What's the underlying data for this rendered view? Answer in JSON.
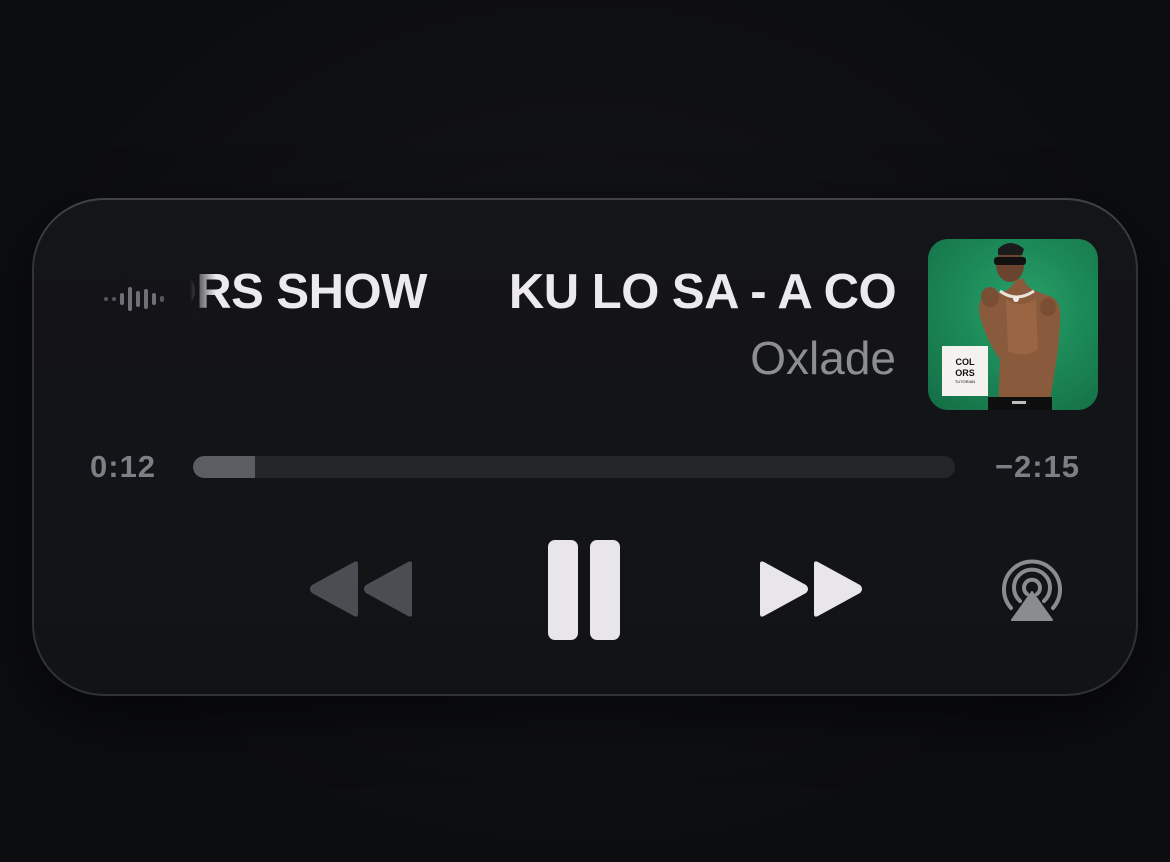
{
  "now_playing": {
    "title": "KU LO SA - A COLORS SHOW",
    "title_visible_tail": "S SHOW",
    "title_visible_head": "KU LO SA - A COL",
    "artist": "Oxlade",
    "album_art_text_line1": "COL",
    "album_art_text_line2": "ORS",
    "album_art_text_line3": "TUTORIAN"
  },
  "progress": {
    "elapsed": "0:12",
    "remaining": "−2:15",
    "fraction": 0.082
  },
  "controls": {
    "rewind_icon": "rewind-icon",
    "pause_icon": "pause-icon",
    "forward_icon": "fast-forward-icon",
    "airplay_icon": "airplay-icon"
  },
  "colors": {
    "background": "#0d0e11",
    "card": "#141518",
    "title": "#eceaec",
    "artist": "#8d8e92",
    "track": "#24262a",
    "track_fill": "#5a5d62",
    "rewind": "#4a4d52",
    "active_control": "#e8e6e8",
    "airplay": "#8a8c90",
    "album_green": "#1c8a58"
  }
}
